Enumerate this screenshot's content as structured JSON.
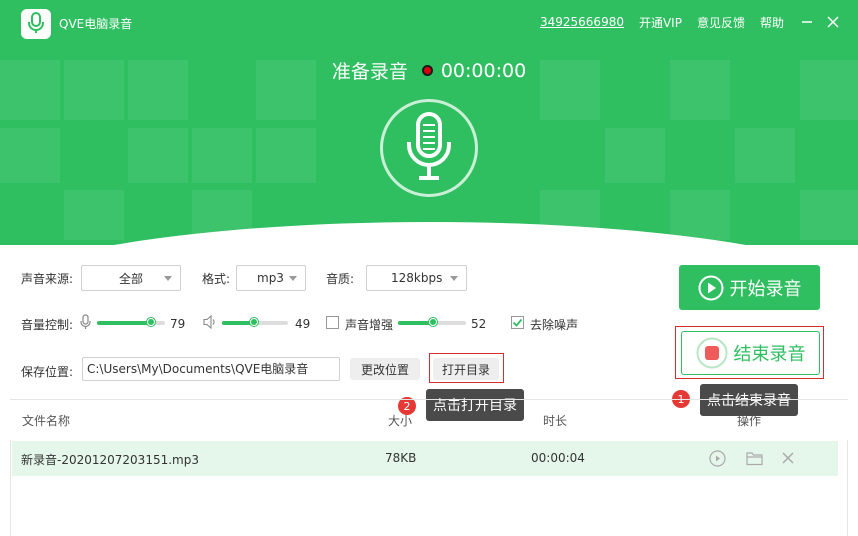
{
  "app": {
    "title": "QVE电脑录音",
    "logo_icon": "mic-icon"
  },
  "topbar": {
    "phone": "34925666980",
    "vip": "开通VIP",
    "feedback": "意见反馈",
    "help": "帮助"
  },
  "status": {
    "text": "准备录音",
    "time": "00:00:00"
  },
  "settings": {
    "source_label": "声音来源:",
    "source_value": "全部",
    "format_label": "格式:",
    "format_value": "mp3",
    "quality_label": "音质:",
    "quality_value": "128kbps",
    "volume_label": "音量控制:",
    "mic_volume": 79,
    "speaker_volume": 49,
    "boost_label": "声音增强",
    "boost_value": 52,
    "boost_checked": false,
    "denoise_label": "去除噪声",
    "denoise_checked": true,
    "save_label": "保存位置:",
    "save_path": "C:\\Users\\My\\Documents\\QVE电脑录音",
    "change_location": "更改位置",
    "open_dir": "打开目录"
  },
  "buttons": {
    "start": "开始录音",
    "stop": "结束录音"
  },
  "tips": {
    "tip1_num": "1",
    "tip1": "点击结束录音",
    "tip2_num": "2",
    "tip2": "点击打开目录"
  },
  "table": {
    "headers": {
      "name": "文件名称",
      "size": "大小",
      "duration": "时长",
      "ops": "操作"
    },
    "rows": [
      {
        "name": "新录音-20201207203151.mp3",
        "size": "78KB",
        "duration": "00:00:04"
      }
    ]
  },
  "colors": {
    "accent": "#2fbf60",
    "highlight": "#d32f2f",
    "row_bg": "#e5f7ea"
  }
}
